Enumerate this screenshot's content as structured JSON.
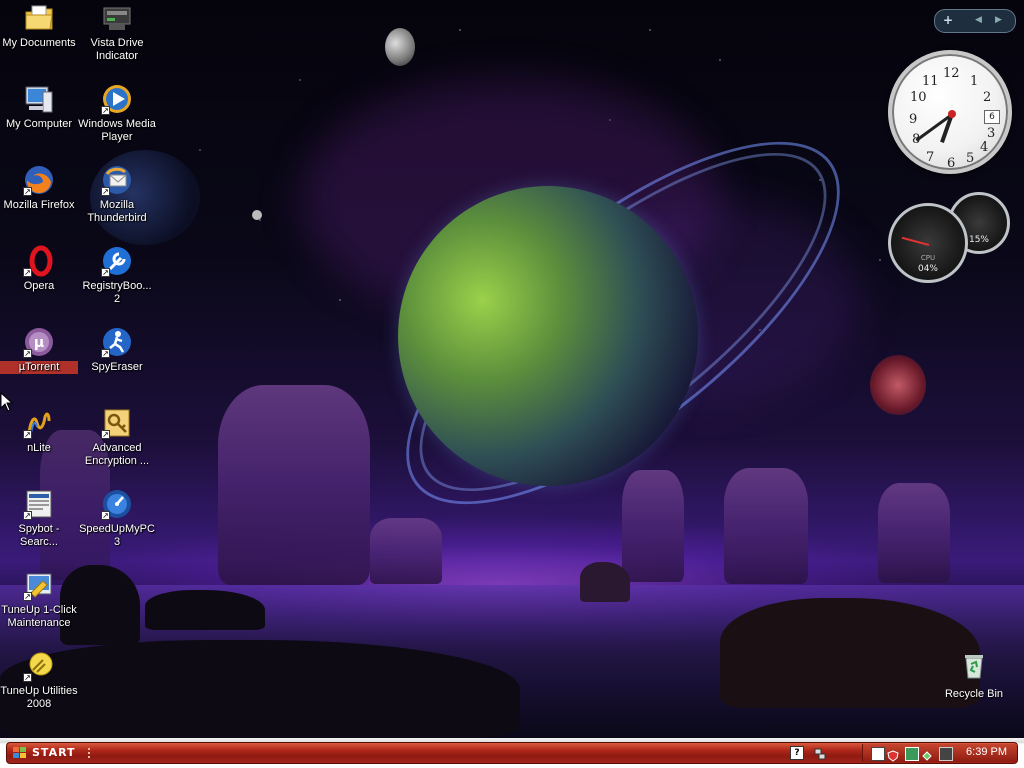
{
  "desktop": {
    "icons_col1": [
      {
        "name": "my-documents",
        "label": "My Documents"
      },
      {
        "name": "my-computer",
        "label": "My Computer"
      },
      {
        "name": "mozilla-firefox",
        "label": "Mozilla Firefox"
      },
      {
        "name": "opera",
        "label": "Opera"
      },
      {
        "name": "utorrent",
        "label": "µTorrent"
      },
      {
        "name": "nlite",
        "label": "nLite"
      },
      {
        "name": "spybot",
        "label": "Spybot - Searc..."
      },
      {
        "name": "tuneup-1click",
        "label": "TuneUp 1-Click Maintenance"
      },
      {
        "name": "tuneup-utilities",
        "label": "TuneUp Utilities 2008"
      }
    ],
    "icons_col2": [
      {
        "name": "vista-drive-indicator",
        "label": "Vista Drive Indicator"
      },
      {
        "name": "windows-media-player",
        "label": "Windows Media Player"
      },
      {
        "name": "mozilla-thunderbird",
        "label": "Mozilla Thunderbird"
      },
      {
        "name": "registrybooster",
        "label": "RegistryBoo... 2"
      },
      {
        "name": "spyeraser",
        "label": "SpyEraser"
      },
      {
        "name": "advanced-encryption",
        "label": "Advanced Encryption ..."
      },
      {
        "name": "speedupmypc",
        "label": "SpeedUpMyPC 3"
      }
    ],
    "recycle_bin": {
      "label": "Recycle Bin"
    }
  },
  "gadgets": {
    "sidebar_controls": {
      "add": "+",
      "prev": "◀",
      "next": "▶"
    },
    "clock": {
      "numbers": [
        "12",
        "1",
        "2",
        "3",
        "4",
        "5",
        "6",
        "7",
        "8",
        "9",
        "10",
        "11"
      ],
      "date": "6",
      "hour": 6,
      "minute": 39
    },
    "cpu_meter": {
      "cpu_label": "CPU",
      "cpu_value": "04%",
      "ram_value": "15%"
    }
  },
  "taskbar": {
    "start_label": "START",
    "clock": "6:39 PM",
    "colors": {
      "bar": "#a12519",
      "accent": "#d95a3c"
    }
  }
}
